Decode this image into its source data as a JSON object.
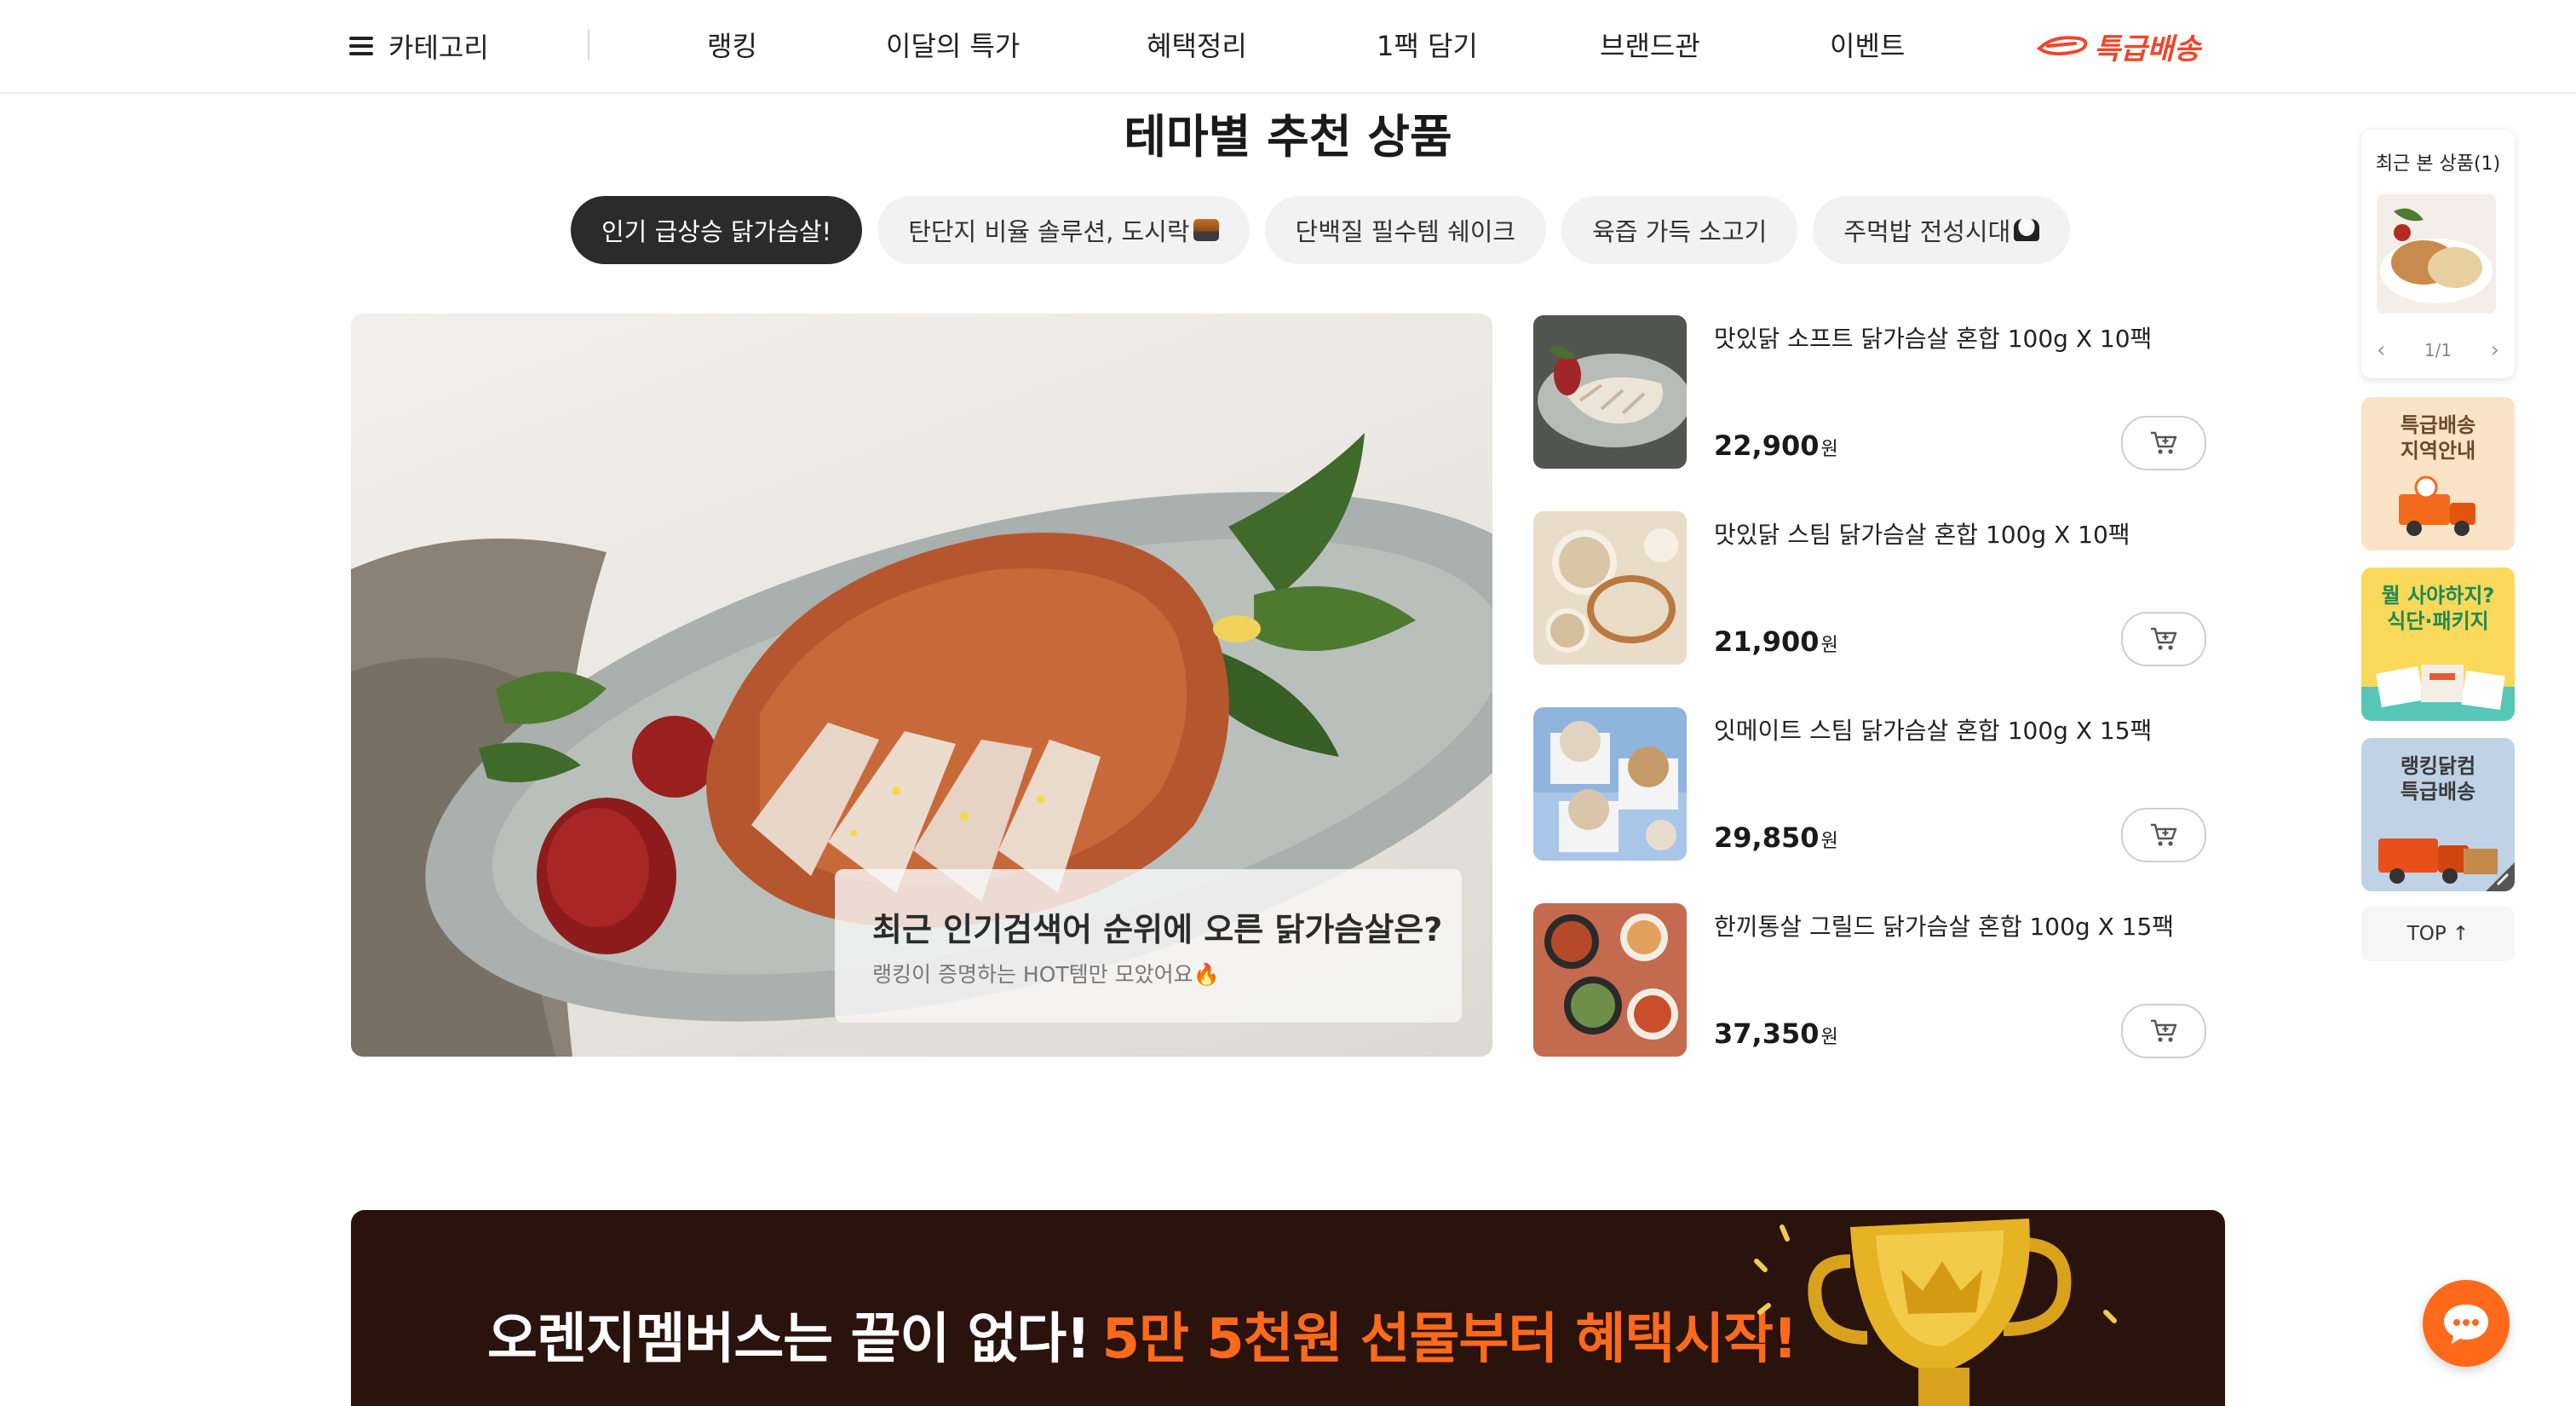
{
  "nav": {
    "category_label": "카테고리",
    "items": [
      "랭킹",
      "이달의 특가",
      "혜택정리",
      "1팩 담기",
      "브랜드관",
      "이벤트"
    ],
    "express_label": "특급배송",
    "icons": [
      "hamburger-menu-icon",
      "express-delivery-logo"
    ]
  },
  "section": {
    "title": "테마별 추천 상품",
    "tabs": [
      {
        "label": "인기 급상승 닭가슴살!",
        "active": true
      },
      {
        "label": "탄단지 비율 솔루션, 도시락",
        "active": false,
        "emoji": "bento-emoji"
      },
      {
        "label": "단백질 필수템 쉐이크",
        "active": false
      },
      {
        "label": "육즙 가득 소고기",
        "active": false
      },
      {
        "label": "주먹밥 전성시대",
        "active": false,
        "emoji": "rice-ball-emoji"
      }
    ]
  },
  "hero": {
    "caption_title": "최근 인기검색어 순위에 오른 닭가슴살은?",
    "caption_subtitle": "랭킹이 증명하는 HOT템만 모았어요🔥"
  },
  "products": [
    {
      "name": "맛있닭 소프트 닭가슴살 혼합 100g X 10팩",
      "price": "22,900",
      "currency": "원"
    },
    {
      "name": "맛있닭 스팀 닭가슴살 혼합 100g X 10팩",
      "price": "21,900",
      "currency": "원"
    },
    {
      "name": "잇메이트 스팀 닭가슴살 혼합 100g X 15팩",
      "price": "29,850",
      "currency": "원"
    },
    {
      "name": "한끼통살 그릴드 닭가슴살 혼합 100g X 15팩",
      "price": "37,350",
      "currency": "원"
    }
  ],
  "banner": {
    "text_white": "오렌지멤버스는 끝이 없다!",
    "text_orange": "5만 5천원 선물부터 혜택시작!"
  },
  "rail": {
    "recent_title": "최근 본 상품(1)",
    "pager": "1/1",
    "cards": [
      {
        "line1": "특급배송",
        "line2": "지역안내",
        "bg": "#fbe3c8",
        "color": "#6b4a2a"
      },
      {
        "line1": "뭘 사야하지?",
        "line2": "식단·패키지",
        "bg": "#f9d85a",
        "color": "#1b8a5a"
      },
      {
        "line1": "랭킹닭컴",
        "line2": "특급배송",
        "bg": "#bfd2e6",
        "color": "#3a3a3a"
      }
    ],
    "top_label": "TOP ↑"
  },
  "colors": {
    "accent_orange": "#ff6a1a",
    "express_red": "#f2452c",
    "tab_active_bg": "#2b2b2b",
    "banner_bg": "#2a120d"
  }
}
